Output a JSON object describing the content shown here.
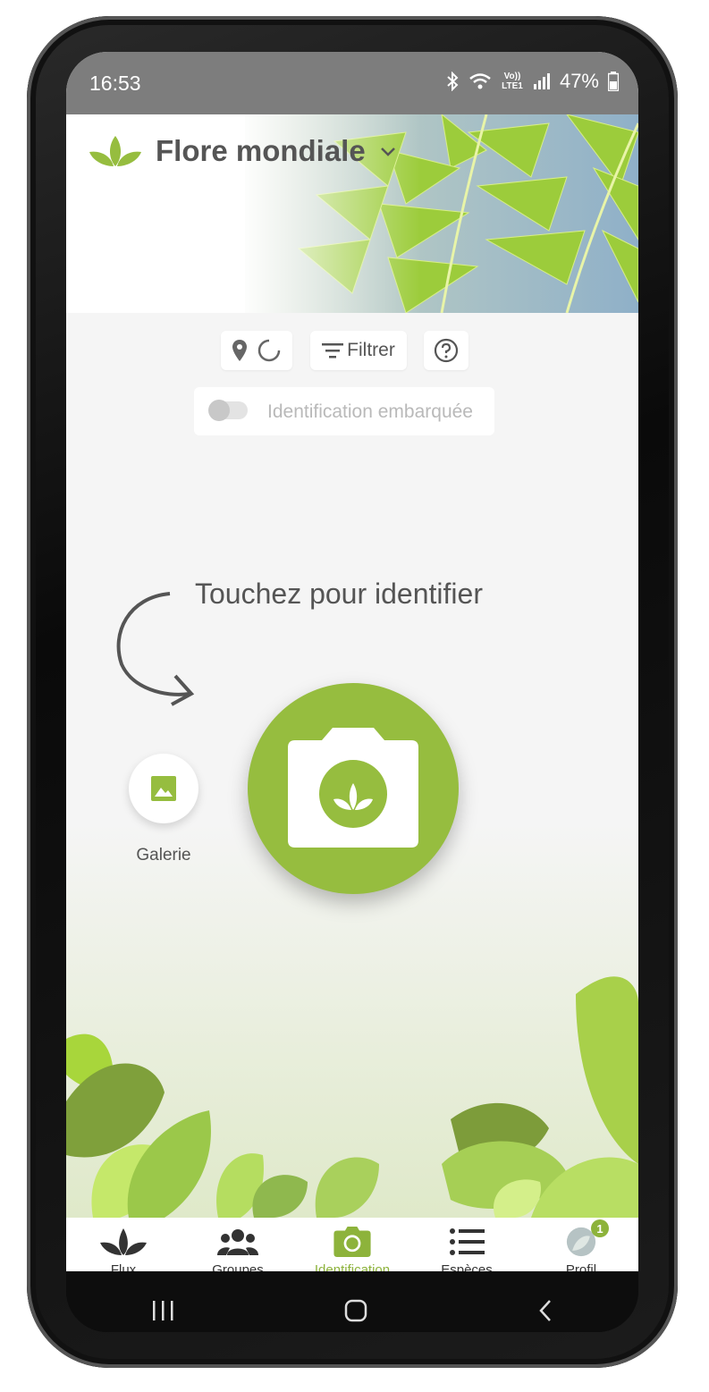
{
  "status": {
    "time": "16:53",
    "network": "Vo)) LTE1",
    "battery": "47%"
  },
  "header": {
    "title": "Flore mondiale"
  },
  "toolbar": {
    "filter_label": "Filtrer"
  },
  "offline": {
    "label": "Identification embarquée",
    "enabled": false
  },
  "main": {
    "prompt": "Touchez pour identifier",
    "gallery_label": "Galerie"
  },
  "nav": {
    "items": [
      {
        "label": "Flux",
        "icon": "leaf-icon"
      },
      {
        "label": "Groupes",
        "icon": "group-icon"
      },
      {
        "label": "Identification",
        "icon": "camera-icon",
        "active": true
      },
      {
        "label": "Espèces",
        "icon": "list-icon"
      },
      {
        "label": "Profil",
        "icon": "avatar",
        "badge": "1"
      }
    ]
  },
  "colors": {
    "accent": "#96bd3f",
    "active_text": "#8db33b",
    "statusbar": "#7d7d7d"
  }
}
